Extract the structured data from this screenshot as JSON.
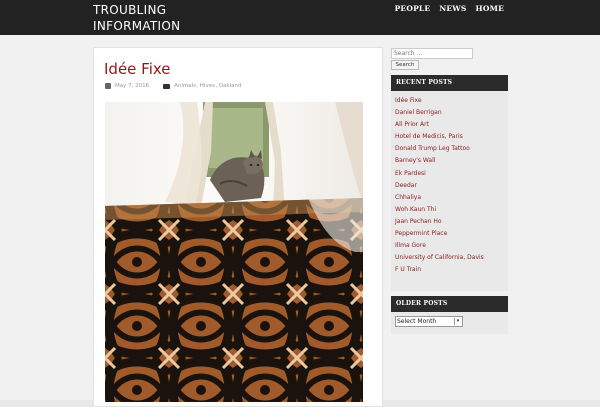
{
  "site": {
    "title": "TROUBLING INFORMATION"
  },
  "nav": {
    "items": [
      "PEOPLE",
      "NEWS",
      "HOME"
    ]
  },
  "post": {
    "title": "Idée Fixe",
    "date": "May 7, 2016",
    "categories": [
      "Animals",
      "Hives",
      "Oakland"
    ]
  },
  "sidebar": {
    "search_placeholder": "Search ...",
    "search_button": "Search",
    "recent_heading": "RECENT POSTS",
    "recent_posts": [
      "Idée Fixe",
      "Daniel Berrigan",
      "All Prior Art",
      "Hotel de Medicis, Paris",
      "Donald Trump Leg Tattoo",
      "Barney's Wall",
      "Ek Pardesi",
      "Deedar",
      "Chhaliya",
      "Woh Kaun Thi",
      "Jaan Pechan Ho",
      "Peppermint Place",
      "Illma Gore",
      "University of California, Davis",
      "F U Train"
    ],
    "older_heading": "OLDER POSTS",
    "older_select": "Select Month"
  },
  "colors": {
    "topbar": "#222222",
    "accent": "#8b1a1a",
    "widget_head": "#2b2b2b"
  },
  "icons": {
    "date": "calendar-icon",
    "category": "folder-icon"
  }
}
